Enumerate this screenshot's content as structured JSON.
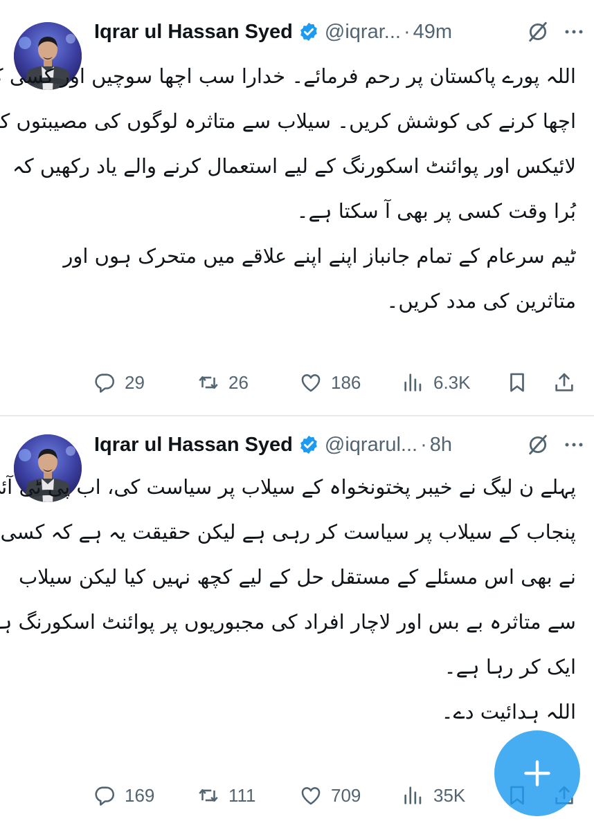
{
  "tweets": [
    {
      "author": {
        "name": "Iqrar ul Hassan Syed",
        "handle": "@iqrar...",
        "verified": true
      },
      "time": "49m",
      "text_lines": [
        "اللہ پورے پاکستان پر رحم فرمائے۔ خدارا سب اچھا سوچیں اور کسی کا",
        "اچھا کرنے کی کوشش کریں۔ سیلاب سے متاثرہ لوگوں کی مصیبتوں کو",
        "لائیکس اور پوائنٹ اسکورنگ کے لیے استعمال کرنے والے یاد رکھیں کہ",
        "بُرا وقت کسی پر بھی آ سکتا ہے۔",
        "ٹیم سرعام کے تمام جانباز اپنے اپنے علاقے میں متحرک ہوں اور",
        "متاثرین کی مدد کریں۔"
      ],
      "stats": {
        "replies": "29",
        "reposts": "26",
        "likes": "186",
        "views": "6.3K"
      }
    },
    {
      "author": {
        "name": "Iqrar ul Hassan Syed",
        "handle": "@iqrarul...",
        "verified": true
      },
      "time": "8h",
      "text_lines": [
        "پہلے ن لیگ نے خیبر پختونخواہ کے سیلاب پر سیاست کی، اب پی ٹی آئی",
        "پنجاب کے سیلاب پر سیاست کر رہی ہے لیکن حقیقت یہ ہے کہ کسی",
        "نے بھی اس مسئلے کے مستقل حل کے لیے کچھ نہیں کیا لیکن سیلاب",
        "سے متاثرہ بے بس اور لاچار افراد کی مجبوریوں پر پوائنٹ اسکورنگ ہر",
        "ایک کر رہا ہے۔",
        "اللہ ہدائیت دے۔"
      ],
      "stats": {
        "replies": "169",
        "reposts": "111",
        "likes": "709",
        "views": "35K"
      }
    }
  ],
  "separator": "·",
  "icons": [
    "verified-badge-icon",
    "grok-icon",
    "more-icon",
    "reply-icon",
    "repost-icon",
    "like-icon",
    "views-icon",
    "bookmark-icon",
    "share-icon",
    "compose-plus-icon"
  ],
  "colors": {
    "accent": "#1d9bf0",
    "text": "#0f1419",
    "muted": "#536471",
    "divider": "#e7e9ea"
  }
}
